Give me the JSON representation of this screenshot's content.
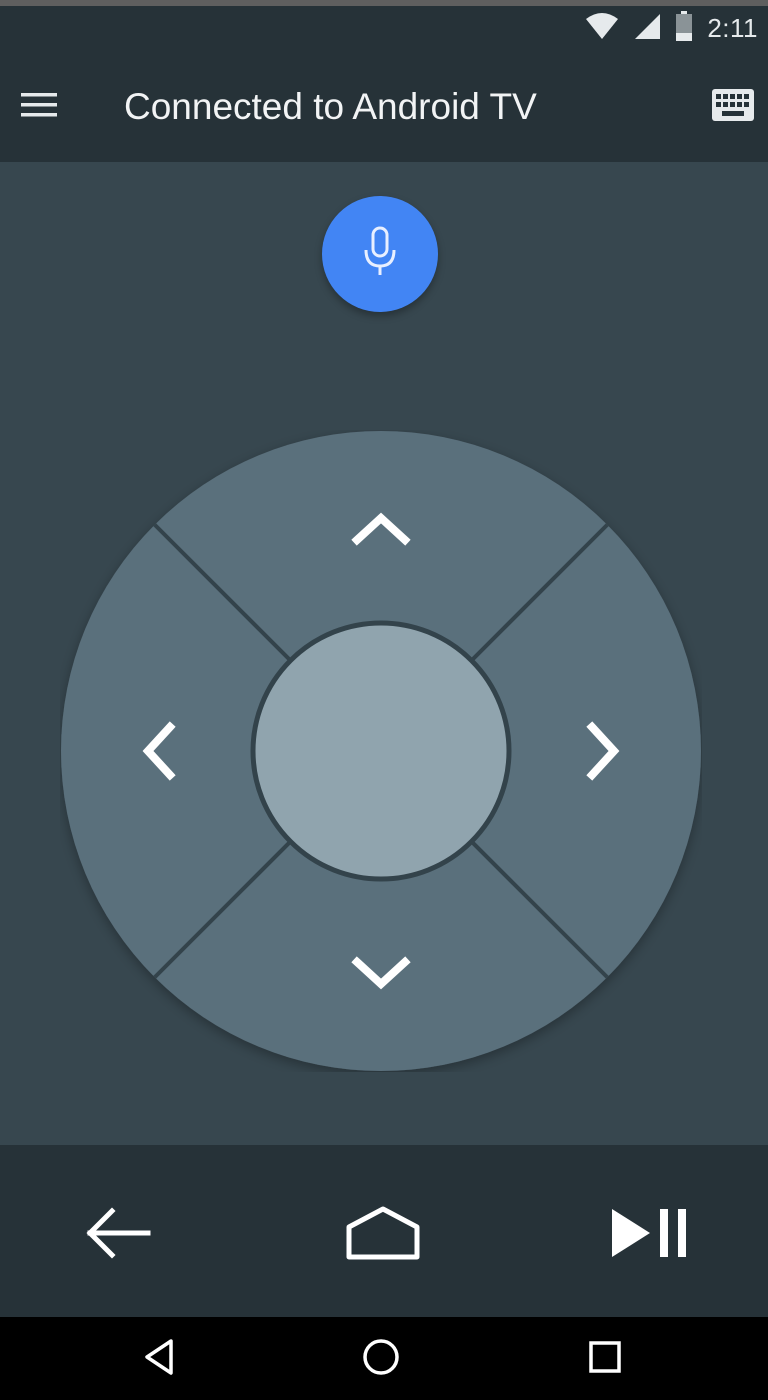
{
  "status_bar": {
    "time": "2:11",
    "icons": [
      "wifi-icon",
      "cellular-signal-icon",
      "battery-icon"
    ]
  },
  "app_bar": {
    "title": "Connected to Android TV",
    "left_icon": "menu-icon",
    "right_icon": "keyboard-icon"
  },
  "remote": {
    "mic_icon": "microphone-icon",
    "dpad_icons": [
      "chevron-up-icon",
      "chevron-left-icon",
      "chevron-right-icon",
      "chevron-down-icon"
    ],
    "center_button": "ok-button"
  },
  "controls": {
    "icons": [
      "back-arrow-icon",
      "home-icon",
      "play-pause-icon"
    ]
  },
  "nav_bar": {
    "icons": [
      "nav-back-icon",
      "nav-home-icon",
      "nav-recents-icon"
    ]
  },
  "colors": {
    "background": "#37474f",
    "bars": "#263238",
    "dpad_outer": "#546e7a",
    "dpad_center": "#90a4ae",
    "mic_accent": "#4285f4"
  }
}
